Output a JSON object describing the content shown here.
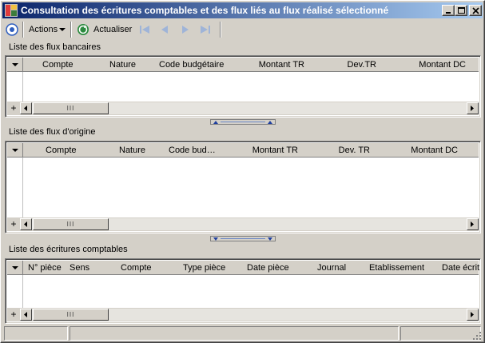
{
  "window": {
    "title": "Consultation des écritures comptables et des flux liés au flux réalisé sélectionné"
  },
  "toolbar": {
    "actions_label": "Actions",
    "refresh_label": "Actualiser"
  },
  "sections": {
    "bank_flows": {
      "label": "Liste des flux bancaires",
      "columns": [
        "Compte",
        "Nature",
        "Code budgétaire",
        "Montant TR",
        "Dev.TR",
        "Montant DC"
      ]
    },
    "origin_flows": {
      "label": "Liste des flux d'origine",
      "columns": [
        "Compte",
        "Nature",
        "Code bud…",
        "Montant TR",
        "Dev. TR",
        "Montant DC"
      ]
    },
    "accounting_entries": {
      "label": "Liste des écritures comptables",
      "columns": [
        "N° pièce",
        "Sens",
        "Compte",
        "Type pièce",
        "Date pièce",
        "Journal",
        "Etablissement",
        "Date écrit"
      ]
    }
  },
  "grid_controls": {
    "add_symbol": "+",
    "thumb_grip": "III"
  },
  "colors": {
    "title_gradient_start": "#0a246a",
    "title_gradient_end": "#a6caf0",
    "chrome": "#d4d0c8",
    "accent_blue": "#2f5fbf"
  }
}
